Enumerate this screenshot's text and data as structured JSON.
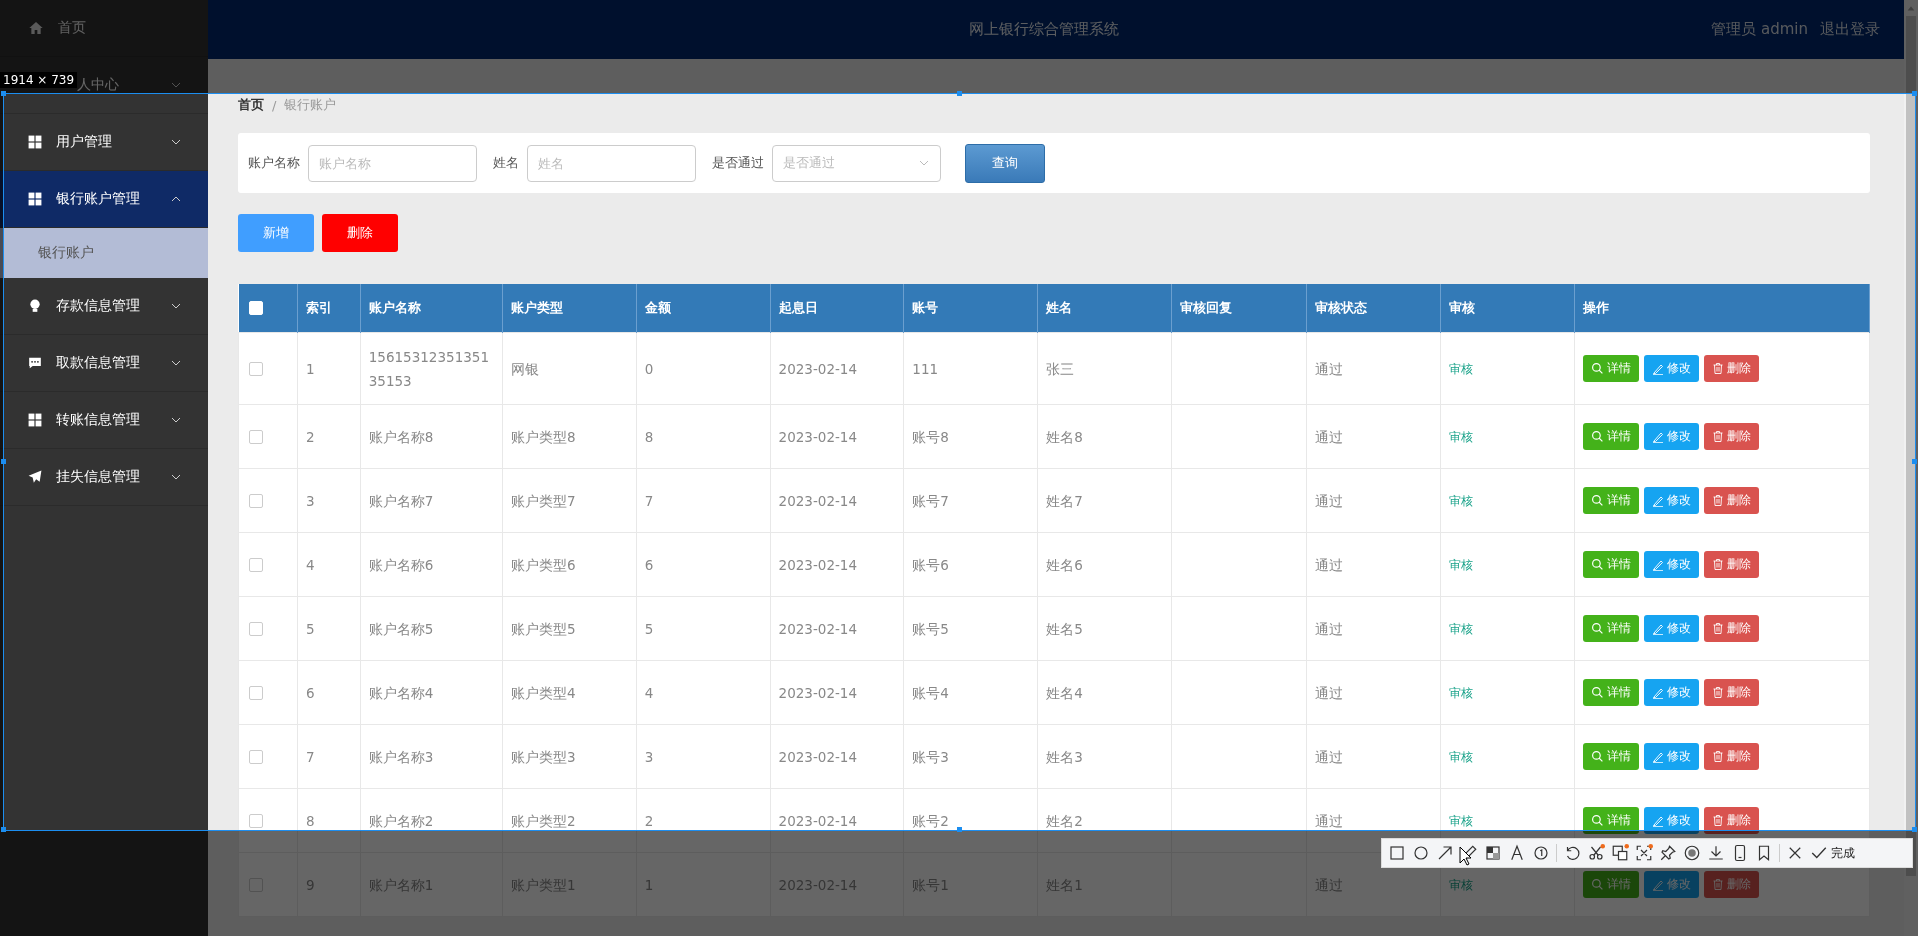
{
  "header": {
    "title": "网上银行综合管理系统",
    "user": "管理员 admin",
    "logout": "退出登录"
  },
  "sidebar": {
    "items": [
      {
        "kind": "link",
        "label": "首页"
      },
      {
        "kind": "menu",
        "label": "人中心",
        "expanded": false
      },
      {
        "kind": "menu",
        "label": "用户管理",
        "expanded": false
      },
      {
        "kind": "menu",
        "label": "银行账户管理",
        "expanded": true,
        "children": [
          {
            "label": "银行账户",
            "selected": true
          }
        ]
      },
      {
        "kind": "menu",
        "label": "存款信息管理",
        "expanded": false
      },
      {
        "kind": "menu",
        "label": "取款信息管理",
        "expanded": false
      },
      {
        "kind": "menu",
        "label": "转账信息管理",
        "expanded": false
      },
      {
        "kind": "menu",
        "label": "挂失信息管理",
        "expanded": false
      }
    ]
  },
  "breadcrumb": {
    "items": [
      "首页",
      "银行账户"
    ],
    "separator": "/"
  },
  "search": {
    "fields": [
      {
        "kind": "input",
        "label": "账户名称",
        "placeholder": "账户名称"
      },
      {
        "kind": "input",
        "label": "姓名",
        "placeholder": "姓名"
      },
      {
        "kind": "select",
        "label": "是否通过",
        "placeholder": "是否通过"
      }
    ],
    "button": "查询"
  },
  "actions": [
    {
      "kind": "primary",
      "label": "新增"
    },
    {
      "kind": "danger",
      "label": "删除"
    }
  ],
  "table": {
    "header_checked": false,
    "columns": [
      "索引",
      "账户名称",
      "账户类型",
      "金额",
      "起息日",
      "账号",
      "姓名",
      "审核回复",
      "审核状态",
      "审核",
      "操作"
    ],
    "rows": [
      {
        "checked": false,
        "cells": [
          "1",
          "1561531235135135153",
          "网银",
          "0",
          "2023-02-14",
          "111",
          "张三",
          "",
          "通过",
          "审核"
        ],
        "buttons": [
          {
            "kind": "detail",
            "label": "详情"
          },
          {
            "kind": "edit",
            "label": "修改"
          },
          {
            "kind": "delete",
            "label": "删除"
          }
        ]
      },
      {
        "checked": false,
        "cells": [
          "2",
          "账户名称8",
          "账户类型8",
          "8",
          "2023-02-14",
          "账号8",
          "姓名8",
          "",
          "通过",
          "审核"
        ],
        "buttons": [
          {
            "kind": "detail",
            "label": "详情"
          },
          {
            "kind": "edit",
            "label": "修改"
          },
          {
            "kind": "delete",
            "label": "删除"
          }
        ]
      },
      {
        "checked": false,
        "cells": [
          "3",
          "账户名称7",
          "账户类型7",
          "7",
          "2023-02-14",
          "账号7",
          "姓名7",
          "",
          "通过",
          "审核"
        ],
        "buttons": [
          {
            "kind": "detail",
            "label": "详情"
          },
          {
            "kind": "edit",
            "label": "修改"
          },
          {
            "kind": "delete",
            "label": "删除"
          }
        ]
      },
      {
        "checked": false,
        "cells": [
          "4",
          "账户名称6",
          "账户类型6",
          "6",
          "2023-02-14",
          "账号6",
          "姓名6",
          "",
          "通过",
          "审核"
        ],
        "buttons": [
          {
            "kind": "detail",
            "label": "详情"
          },
          {
            "kind": "edit",
            "label": "修改"
          },
          {
            "kind": "delete",
            "label": "删除"
          }
        ]
      },
      {
        "checked": false,
        "cells": [
          "5",
          "账户名称5",
          "账户类型5",
          "5",
          "2023-02-14",
          "账号5",
          "姓名5",
          "",
          "通过",
          "审核"
        ],
        "buttons": [
          {
            "kind": "detail",
            "label": "详情"
          },
          {
            "kind": "edit",
            "label": "修改"
          },
          {
            "kind": "delete",
            "label": "删除"
          }
        ]
      },
      {
        "checked": false,
        "cells": [
          "6",
          "账户名称4",
          "账户类型4",
          "4",
          "2023-02-14",
          "账号4",
          "姓名4",
          "",
          "通过",
          "审核"
        ],
        "buttons": [
          {
            "kind": "detail",
            "label": "详情"
          },
          {
            "kind": "edit",
            "label": "修改"
          },
          {
            "kind": "delete",
            "label": "删除"
          }
        ]
      },
      {
        "checked": false,
        "cells": [
          "7",
          "账户名称3",
          "账户类型3",
          "3",
          "2023-02-14",
          "账号3",
          "姓名3",
          "",
          "通过",
          "审核"
        ],
        "buttons": [
          {
            "kind": "detail",
            "label": "详情"
          },
          {
            "kind": "edit",
            "label": "修改"
          },
          {
            "kind": "delete",
            "label": "删除"
          }
        ]
      },
      {
        "checked": false,
        "cells": [
          "8",
          "账户名称2",
          "账户类型2",
          "2",
          "2023-02-14",
          "账号2",
          "姓名2",
          "",
          "通过",
          "审核"
        ],
        "buttons": [
          {
            "kind": "detail",
            "label": "详情"
          },
          {
            "kind": "edit",
            "label": "修改"
          },
          {
            "kind": "delete",
            "label": "删除"
          }
        ]
      },
      {
        "checked": false,
        "cells": [
          "9",
          "账户名称1",
          "账户类型1",
          "1",
          "2023-02-14",
          "账号1",
          "姓名1",
          "",
          "通过",
          "审核"
        ],
        "buttons": [
          {
            "kind": "detail",
            "label": "详情"
          },
          {
            "kind": "edit",
            "label": "修改"
          },
          {
            "kind": "delete",
            "label": "删除"
          }
        ]
      }
    ]
  },
  "capture": {
    "size_label": "1914 × 739",
    "done_label": "完成"
  }
}
